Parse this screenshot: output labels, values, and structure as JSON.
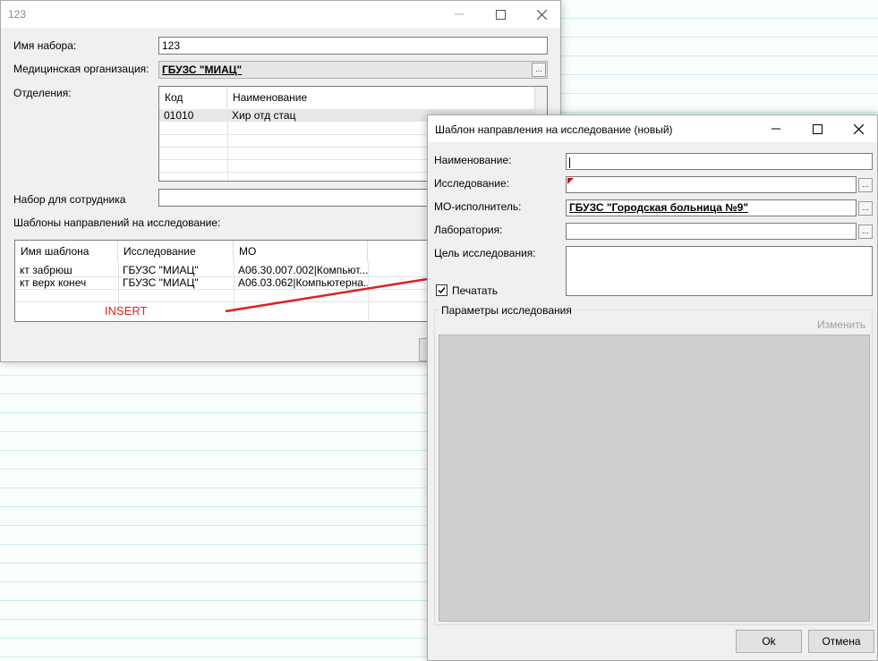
{
  "main_window": {
    "title": "123",
    "name_label": "Имя набора:",
    "name_value": "123",
    "org_label": "Медицинская организация:",
    "org_value": "ГБУЗС \"МИАЦ\"",
    "dept_label": "Отделения:",
    "dept_columns": [
      "Код",
      "Наименование"
    ],
    "dept_rows": [
      {
        "code": "01010",
        "name": "Хир отд стац"
      }
    ],
    "employee_label": "Набор для сотрудника",
    "employee_value": "",
    "templates_label": "Шаблоны направлений на исследование:",
    "template_columns": [
      "Имя шаблона",
      "Исследование",
      "МО"
    ],
    "template_rows": [
      {
        "name": "кт забрюш",
        "research": "ГБУЗС \"МИАЦ\"",
        "mo": "A06.30.007.002|Компьют..."
      },
      {
        "name": "кт верх конеч",
        "research": "ГБУЗС \"МИАЦ\"",
        "mo": "A06.03.062|Компьютерна..."
      }
    ]
  },
  "annotation": {
    "insert_text": "INSERT",
    "color": "#e02020"
  },
  "dialog": {
    "title": "Шаблон направления на исследование (новый)",
    "name_label": "Наименование:",
    "name_value": "",
    "research_label": "Исследование:",
    "research_value": "",
    "mo_label": "МО-исполнитель:",
    "mo_value": "ГБУЗС \"Городская больница №9\"",
    "lab_label": "Лаборатория:",
    "lab_value": "",
    "purpose_label": "Цель исследования:",
    "purpose_value": "",
    "print_label": "Печатать",
    "print_checked": true,
    "params_group_label": "Параметры исследования",
    "change_label": "Изменить",
    "ok_label": "Ok",
    "cancel_label": "Отмена"
  },
  "icons": {
    "minimize": "minimize-icon",
    "maximize": "maximize-icon",
    "close": "close-icon",
    "ellipsis": "ellipsis-icon",
    "checkmark": "checkmark-icon"
  }
}
